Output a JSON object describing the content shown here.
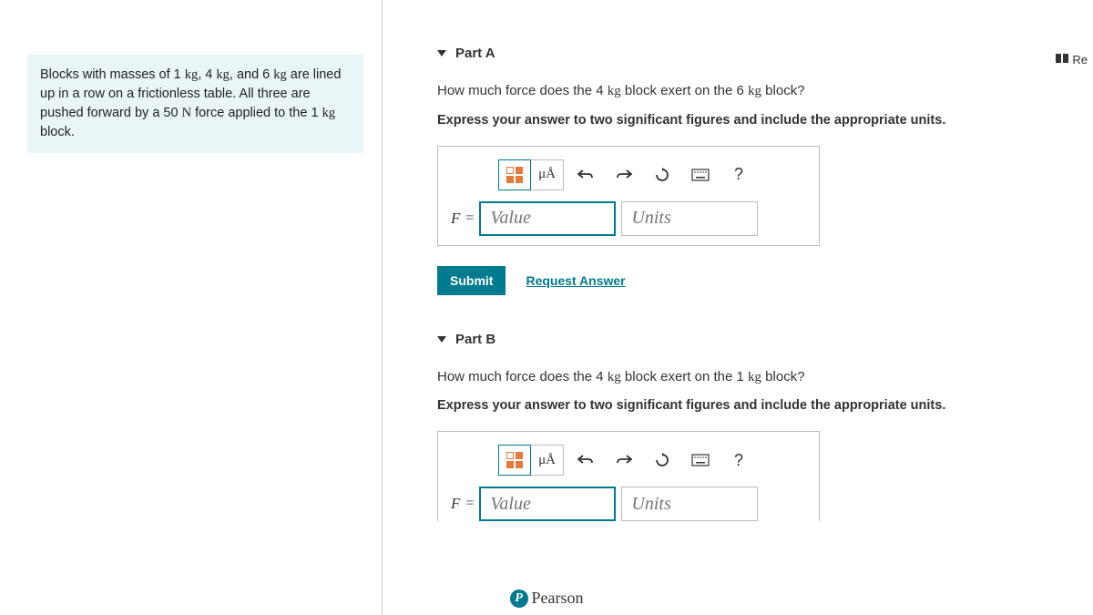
{
  "topRight": {
    "reLabel": "Re"
  },
  "problem": {
    "prefix": "Blocks with masses of 1 ",
    "u1": "kg",
    "mid1": ", 4 ",
    "u2": "kg",
    "mid2": ", and 6 ",
    "u3": "kg",
    "mid3": " are lined up in a row on a frictionless table. All three are pushed forward by a 50 ",
    "u4": "N",
    "mid4": " force applied to the 1 ",
    "u5": "kg",
    "suffix": " block."
  },
  "partA": {
    "title": "Part A",
    "q_p1": "How much force does the 4 ",
    "q_u1": "kg",
    "q_p2": " block exert on the 6 ",
    "q_u2": "kg",
    "q_p3": " block?",
    "instruction": "Express your answer to two significant figures and include the appropriate units.",
    "unitsBtn": "μÅ",
    "helpBtn": "?",
    "varLabel": "F",
    "eq": " = ",
    "valuePlaceholder": "Value",
    "unitsPlaceholder": "Units",
    "submit": "Submit",
    "request": "Request Answer"
  },
  "partB": {
    "title": "Part B",
    "q_p1": "How much force does the 4 ",
    "q_u1": "kg",
    "q_p2": " block exert on the 1 ",
    "q_u2": "kg",
    "q_p3": " block?",
    "instruction": "Express your answer to two significant figures and include the appropriate units.",
    "unitsBtn": "μÅ",
    "helpBtn": "?",
    "varLabel": "F",
    "eq": " = ",
    "valuePlaceholder": "Value",
    "unitsPlaceholder": "Units"
  },
  "footer": {
    "brand": "Pearson"
  }
}
